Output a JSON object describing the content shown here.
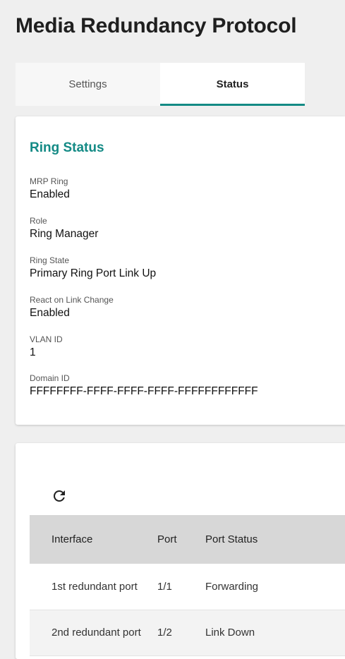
{
  "page": {
    "title": "Media Redundancy Protocol"
  },
  "tabs": [
    {
      "label": "Settings"
    },
    {
      "label": "Status"
    }
  ],
  "ring_status": {
    "title": "Ring Status",
    "fields": [
      {
        "label": "MRP Ring",
        "value": "Enabled"
      },
      {
        "label": "Role",
        "value": "Ring Manager"
      },
      {
        "label": "Ring State",
        "value": "Primary Ring Port Link Up"
      },
      {
        "label": "React on Link Change",
        "value": "Enabled"
      },
      {
        "label": "VLAN ID",
        "value": "1"
      },
      {
        "label": "Domain ID",
        "value": "FFFFFFFF-FFFF-FFFF-FFFF-FFFFFFFFFFFF"
      }
    ]
  },
  "port_table": {
    "refresh_icon": "refresh-icon",
    "columns": [
      "Interface",
      "Port",
      "Port Status"
    ],
    "rows": [
      {
        "interface": "1st redundant port",
        "port": "1/1",
        "status": "Forwarding"
      },
      {
        "interface": "2nd redundant port",
        "port": "1/2",
        "status": "Link Down"
      }
    ]
  },
  "colors": {
    "accent": "#138a85",
    "header_bg": "#d7d7d7",
    "page_bg": "#efefef"
  }
}
